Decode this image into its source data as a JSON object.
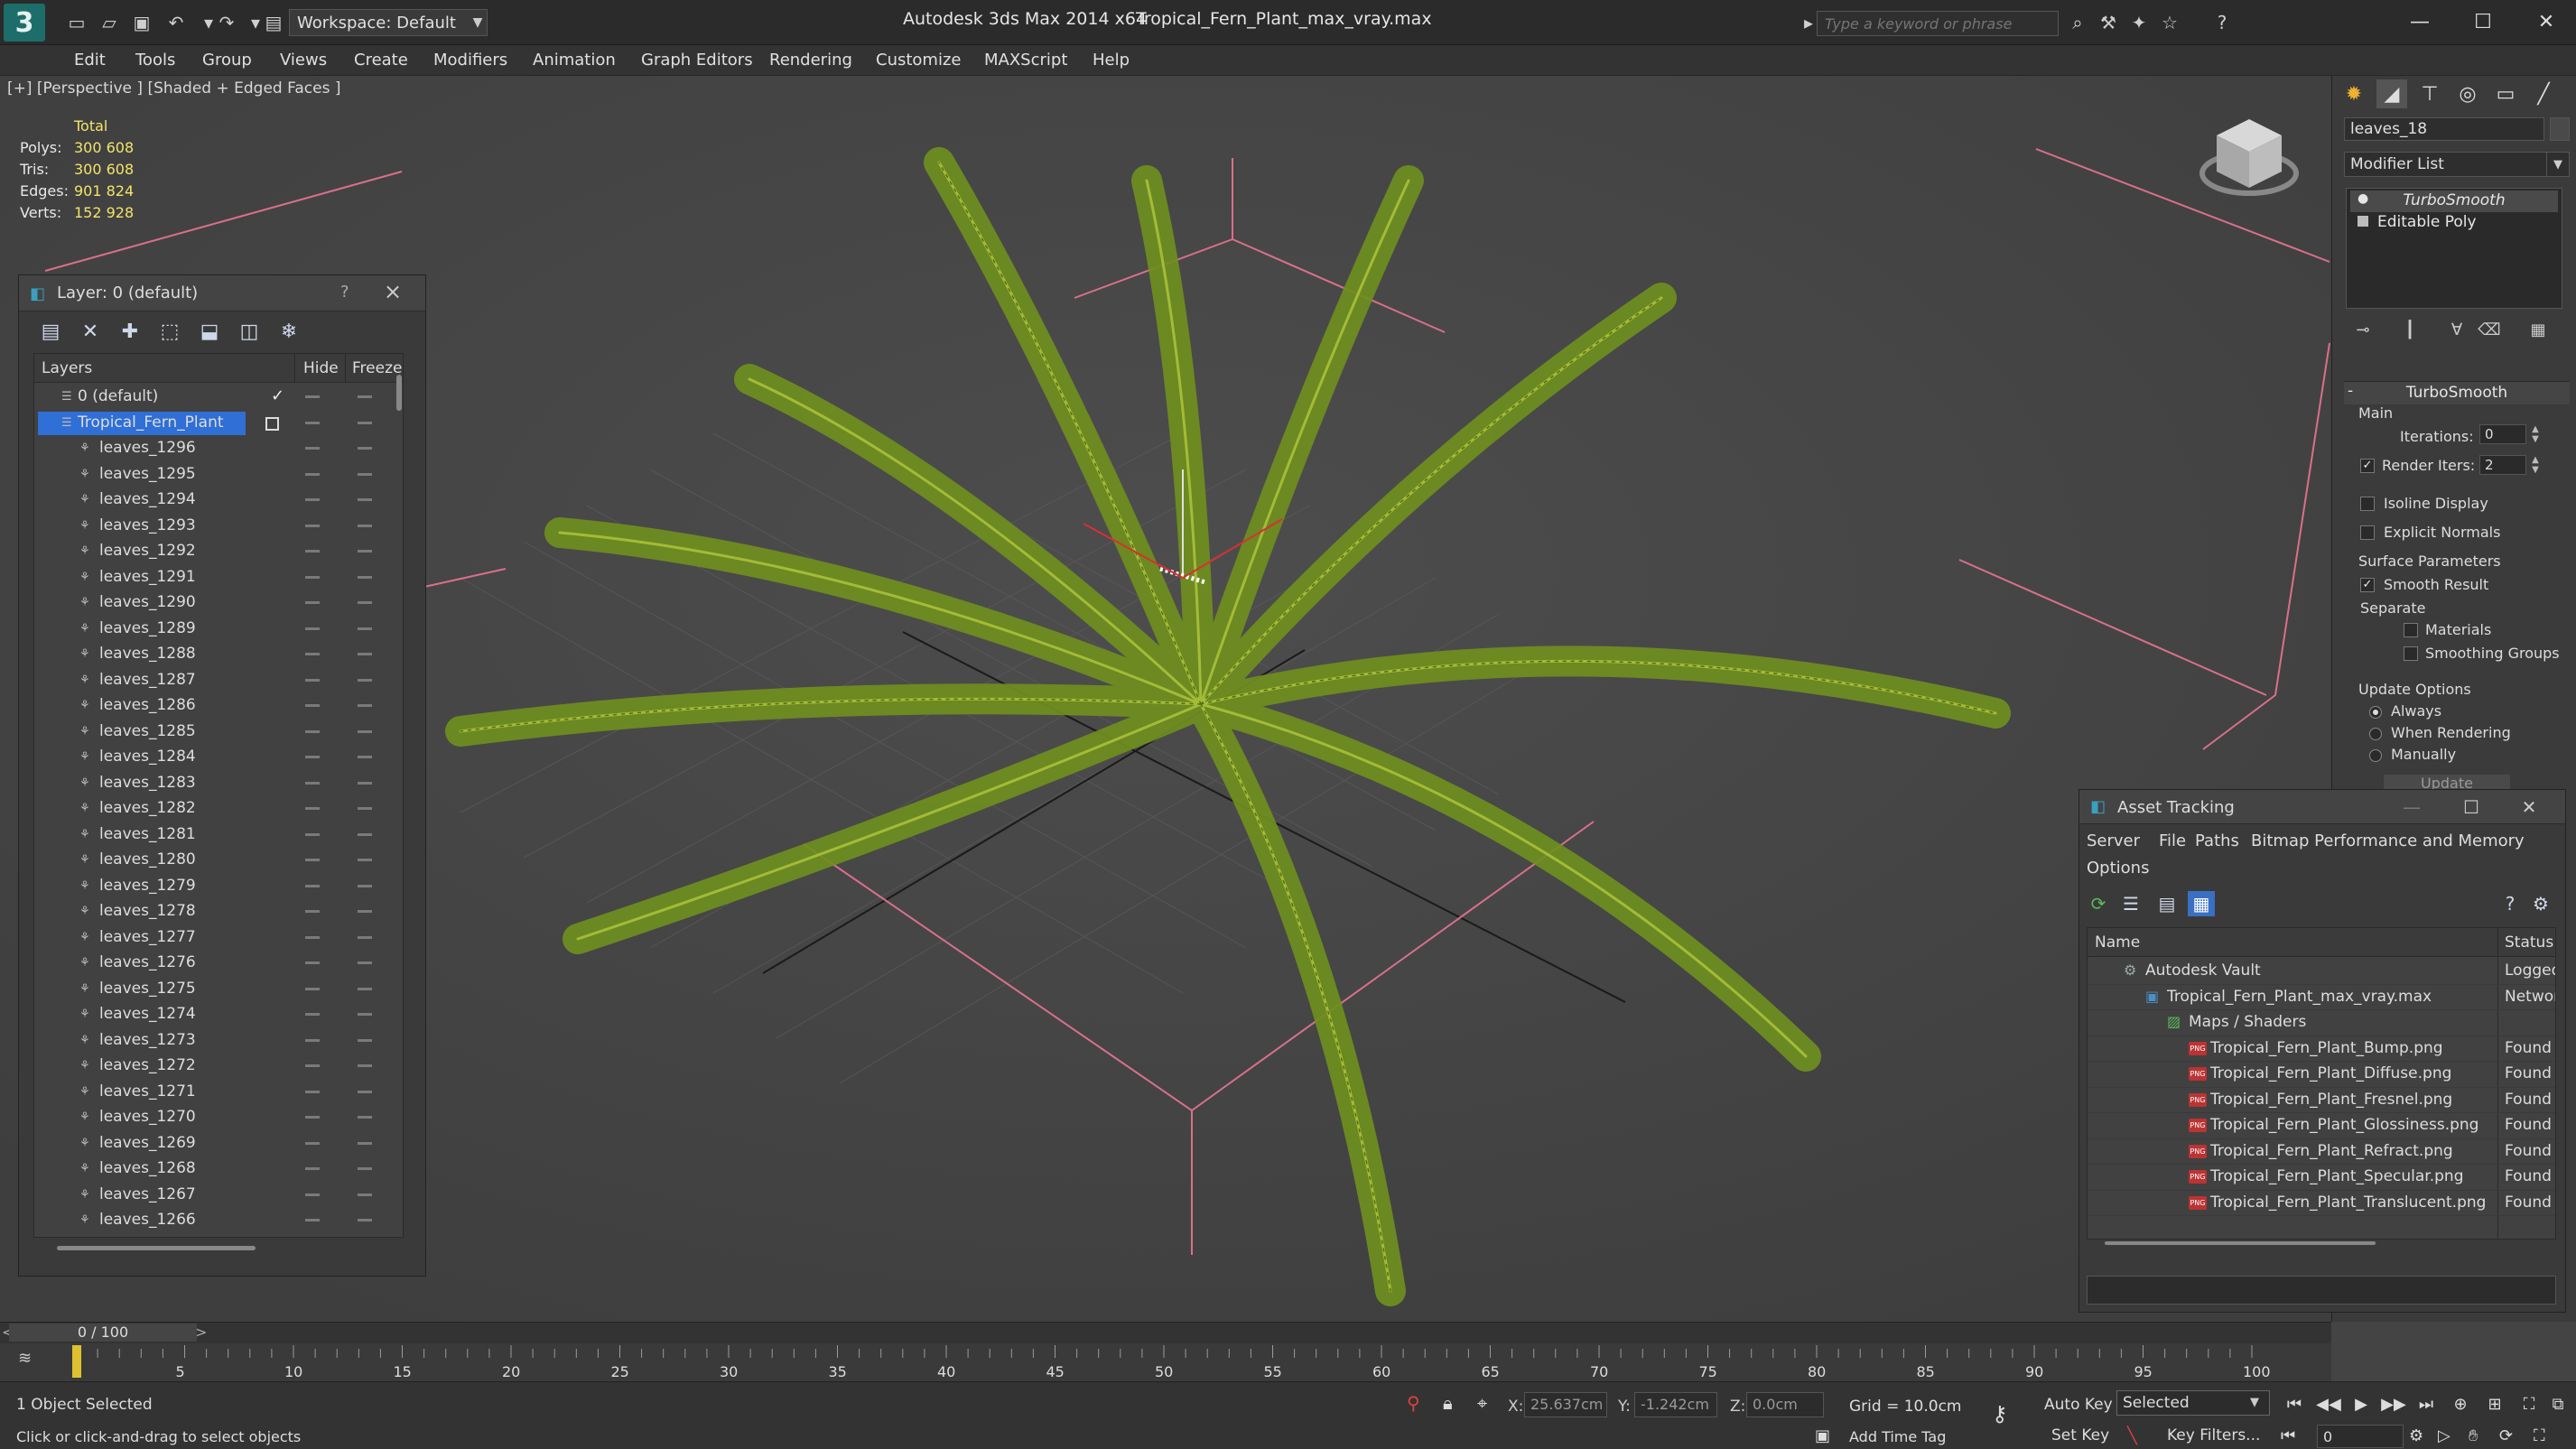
{
  "titlebar": {
    "workspace": "Workspace: Default",
    "app_title": "Autodesk 3ds Max  2014 x64",
    "file_title": "Tropical_Fern_Plant_max_vray.max",
    "search_placeholder": "Type a keyword or phrase"
  },
  "menu": [
    "Edit",
    "Tools",
    "Group",
    "Views",
    "Create",
    "Modifiers",
    "Animation",
    "Graph Editors",
    "Rendering",
    "Customize",
    "MAXScript",
    "Help"
  ],
  "viewport": {
    "label": "[+] [Perspective ] [Shaded + Edged Faces ]",
    "stats": {
      "header": "Total",
      "rows": [
        {
          "k": "Polys:",
          "v": "300 608"
        },
        {
          "k": "Tris:",
          "v": "300 608"
        },
        {
          "k": "Edges:",
          "v": "901 824"
        },
        {
          "k": "Verts:",
          "v": "152 928"
        }
      ]
    }
  },
  "layer_dialog": {
    "title": "Layer: 0 (default)",
    "help": "?",
    "columns": {
      "layers": "Layers",
      "hide": "Hide",
      "freeze": "Freeze"
    },
    "rows": [
      {
        "name": "0 (default)",
        "kind": "layer",
        "active": true
      },
      {
        "name": "Tropical_Fern_Plant",
        "kind": "layer",
        "selected": true
      },
      {
        "name": "leaves_1296"
      },
      {
        "name": "leaves_1295"
      },
      {
        "name": "leaves_1294"
      },
      {
        "name": "leaves_1293"
      },
      {
        "name": "leaves_1292"
      },
      {
        "name": "leaves_1291"
      },
      {
        "name": "leaves_1290"
      },
      {
        "name": "leaves_1289"
      },
      {
        "name": "leaves_1288"
      },
      {
        "name": "leaves_1287"
      },
      {
        "name": "leaves_1286"
      },
      {
        "name": "leaves_1285"
      },
      {
        "name": "leaves_1284"
      },
      {
        "name": "leaves_1283"
      },
      {
        "name": "leaves_1282"
      },
      {
        "name": "leaves_1281"
      },
      {
        "name": "leaves_1280"
      },
      {
        "name": "leaves_1279"
      },
      {
        "name": "leaves_1278"
      },
      {
        "name": "leaves_1277"
      },
      {
        "name": "leaves_1276"
      },
      {
        "name": "leaves_1275"
      },
      {
        "name": "leaves_1274"
      },
      {
        "name": "leaves_1273"
      },
      {
        "name": "leaves_1272"
      },
      {
        "name": "leaves_1271"
      },
      {
        "name": "leaves_1270"
      },
      {
        "name": "leaves_1269"
      },
      {
        "name": "leaves_1268"
      },
      {
        "name": "leaves_1267"
      },
      {
        "name": "leaves_1266"
      }
    ]
  },
  "command_panel": {
    "object_name": "leaves_18",
    "modifier_list": "Modifier List",
    "stack": [
      "TurboSmooth",
      "Editable Poly"
    ],
    "rollout": "TurboSmooth",
    "main": "Main",
    "iterations_label": "Iterations:",
    "iterations": "0",
    "render_iters_label": "Render Iters:",
    "render_iters": "2",
    "isoline": "Isoline Display",
    "explicit_normals": "Explicit Normals",
    "surface_params": "Surface Parameters",
    "smooth_result": "Smooth Result",
    "separate": "Separate",
    "materials": "Materials",
    "smoothing_groups": "Smoothing Groups",
    "update_options": "Update Options",
    "always": "Always",
    "when_rendering": "When Rendering",
    "manually": "Manually",
    "update": "Update"
  },
  "asset_tracking": {
    "title": "Asset Tracking",
    "menu": [
      "Server",
      "File",
      "Paths",
      "Bitmap Performance and Memory",
      "Options"
    ],
    "columns": {
      "name": "Name",
      "status": "Status"
    },
    "rows": [
      {
        "name": "Autodesk Vault",
        "status": "Logged",
        "indent": 0,
        "icon": "vault"
      },
      {
        "name": "Tropical_Fern_Plant_max_vray.max",
        "status": "Network",
        "indent": 1,
        "icon": "max"
      },
      {
        "name": "Maps / Shaders",
        "status": "",
        "indent": 2,
        "icon": "folder"
      },
      {
        "name": "Tropical_Fern_Plant_Bump.png",
        "status": "Found",
        "indent": 3,
        "icon": "png"
      },
      {
        "name": "Tropical_Fern_Plant_Diffuse.png",
        "status": "Found",
        "indent": 3,
        "icon": "png"
      },
      {
        "name": "Tropical_Fern_Plant_Fresnel.png",
        "status": "Found",
        "indent": 3,
        "icon": "png"
      },
      {
        "name": "Tropical_Fern_Plant_Glossiness.png",
        "status": "Found",
        "indent": 3,
        "icon": "png"
      },
      {
        "name": "Tropical_Fern_Plant_Refract.png",
        "status": "Found",
        "indent": 3,
        "icon": "png"
      },
      {
        "name": "Tropical_Fern_Plant_Specular.png",
        "status": "Found",
        "indent": 3,
        "icon": "png"
      },
      {
        "name": "Tropical_Fern_Plant_Translucent.png",
        "status": "Found",
        "indent": 3,
        "icon": "png"
      }
    ]
  },
  "timeline": {
    "frame": "0 / 100",
    "ticks": [
      "5",
      "10",
      "15",
      "20",
      "25",
      "30",
      "35",
      "40",
      "45",
      "50",
      "55",
      "60",
      "65",
      "70",
      "75",
      "80",
      "85",
      "90",
      "95",
      "100"
    ]
  },
  "status": {
    "selection": "1 Object Selected",
    "prompt": "Click or click-and-drag to select objects",
    "x_label": "X:",
    "x": "25.637cm",
    "y_label": "Y:",
    "y": "-1.242cm",
    "z_label": "Z:",
    "z": "0.0cm",
    "grid": "Grid = 10.0cm",
    "add_time_tag": "Add Time Tag",
    "auto_key": "Auto Key",
    "selected": "Selected",
    "set_key": "Set Key",
    "key_filters": "Key Filters...",
    "frame_field": "0"
  },
  "colors": {
    "accent": "#1d6e6a",
    "selection": "#2f6fd6",
    "stat_value": "#f2e46a",
    "fern": "#6f8f1f"
  }
}
